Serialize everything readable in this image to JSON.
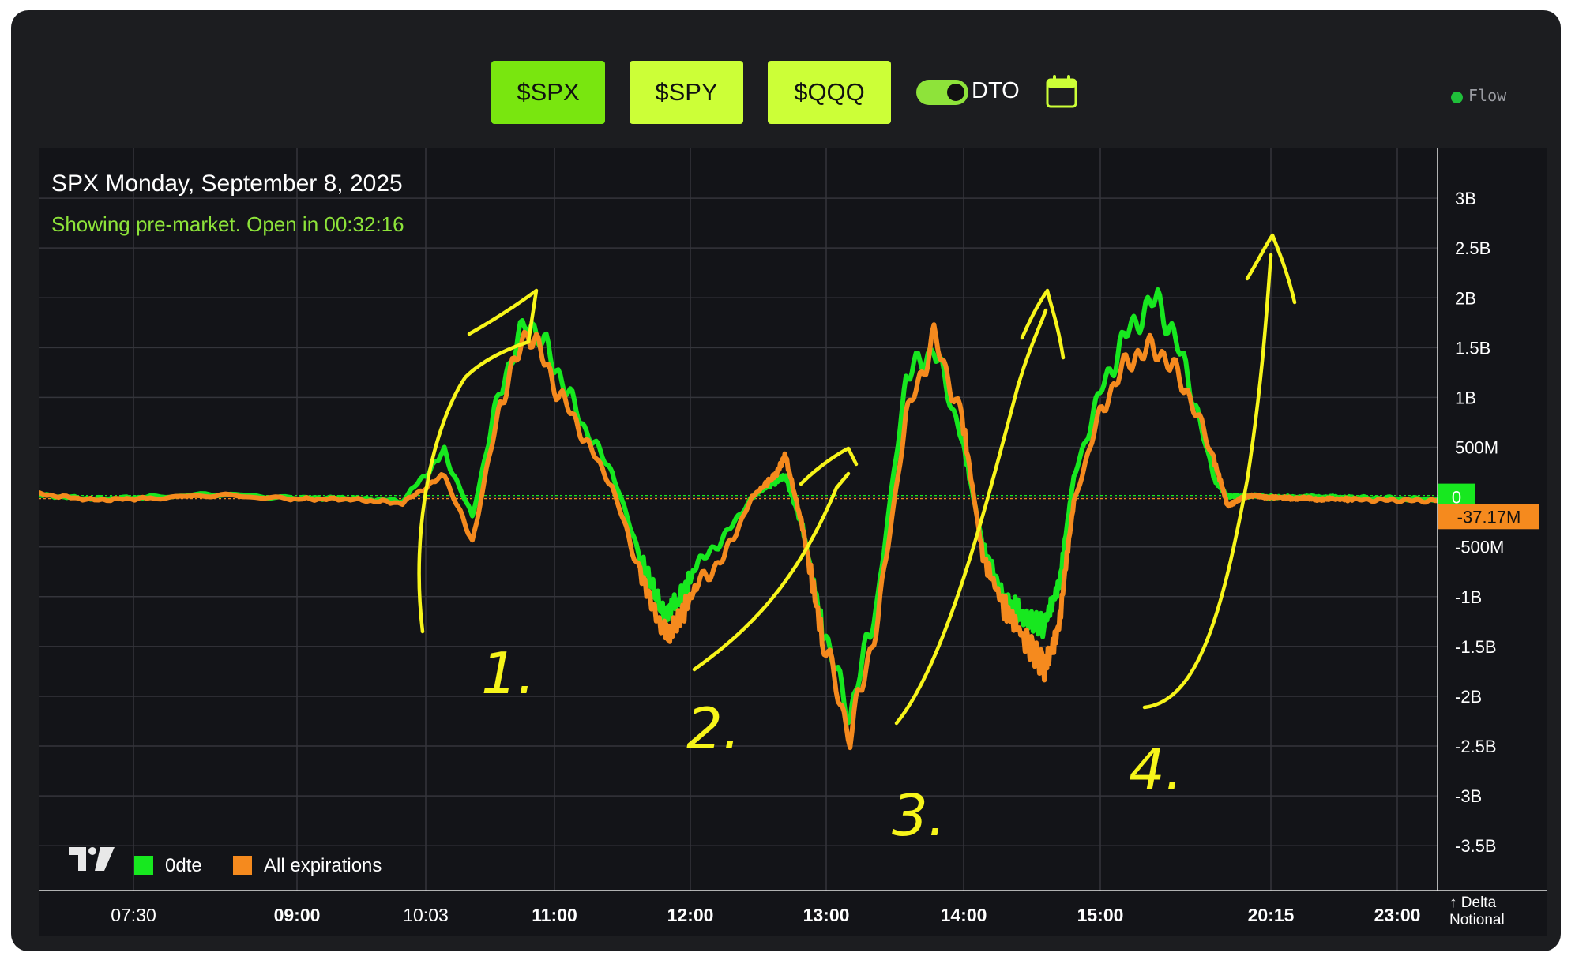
{
  "toolbar": {
    "buttons": [
      "$SPX",
      "$SPY",
      "$QQQ"
    ],
    "active_button": "$SPX",
    "toggle_label": "DTO",
    "toggle_on": true,
    "calendar_icon": "calendar-icon",
    "flow_label": "Flow",
    "colors": {
      "active": "#79e60f",
      "inactive": "#ccff37",
      "flow_dot": "#1fbf3a"
    }
  },
  "chart_data": {
    "type": "line",
    "title": "SPX Monday, September 8, 2025",
    "subtitle": "Showing pre-market. Open in 00:32:16",
    "x_tick_labels": [
      "07:30",
      "09:00",
      "10:03",
      "11:00",
      "12:00",
      "13:00",
      "14:00",
      "15:00",
      "20:15",
      "23:00"
    ],
    "bold_x_ticks": [
      "09:00",
      "11:00",
      "12:00",
      "13:00",
      "14:00",
      "15:00",
      "20:15",
      "23:00"
    ],
    "y_tick_labels": [
      "3B",
      "2.5B",
      "2B",
      "1.5B",
      "1B",
      "500M",
      "0",
      "-500M",
      "-1B",
      "-1.5B",
      "-2B",
      "-2.5B",
      "-3B",
      "-3.5B"
    ],
    "y_ticks": [
      3000,
      2500,
      2000,
      1500,
      1000,
      500,
      0,
      -500,
      -1000,
      -1500,
      -2000,
      -2500,
      -3000,
      -3500
    ],
    "ylim": [
      -3950,
      3500
    ],
    "y_unit": "M",
    "axis_label": "↑ Delta Notional",
    "zero_label": "0",
    "last_value_label": "-37.17M",
    "grid": true,
    "legend": {
      "position": "bottom-left",
      "logo": "tradingview-logo",
      "entries": [
        {
          "name": "0dte",
          "color": "#17e81f"
        },
        {
          "name": "All expirations",
          "color": "#f58a1e"
        }
      ]
    },
    "annotations": [
      "1.",
      "2.",
      "3.",
      "4."
    ],
    "x_positions": [
      0,
      4,
      8,
      13,
      18,
      22,
      26,
      29,
      31,
      33,
      35,
      37,
      39,
      41,
      43,
      44.6,
      45.5,
      47,
      49,
      51,
      52.5,
      53.4,
      54.6,
      56,
      58,
      60,
      62,
      64,
      66,
      67.5,
      69,
      70.4,
      72,
      73,
      74,
      76,
      78,
      80,
      82,
      84,
      85,
      86,
      87,
      88,
      89.5,
      90.5,
      91.5,
      92.5,
      94,
      96,
      98,
      100
    ],
    "series": [
      {
        "name": "0dte",
        "color": "#17e81f",
        "values": [
          20,
          -20,
          0,
          30,
          -10,
          -10,
          -40,
          450,
          -200,
          1100,
          1800,
          1300,
          700,
          250,
          -600,
          -1150,
          -1100,
          -700,
          -400,
          0,
          150,
          200,
          -300,
          -1300,
          -2200,
          -1000,
          1200,
          1500,
          600,
          -500,
          -1000,
          -1200,
          -1300,
          -800,
          200,
          1100,
          1700,
          2000,
          1300,
          200,
          0,
          10,
          10,
          0,
          0,
          0,
          0,
          0,
          -10,
          -10,
          -20,
          -20
        ]
      },
      {
        "name": "All expirations",
        "color": "#f58a1e",
        "values": [
          30,
          -30,
          -10,
          20,
          -20,
          -20,
          -60,
          220,
          -450,
          950,
          1700,
          1100,
          600,
          100,
          -750,
          -1350,
          -1300,
          -900,
          -600,
          0,
          200,
          400,
          -300,
          -1400,
          -2400,
          -1200,
          800,
          1600,
          800,
          -600,
          -1100,
          -1400,
          -1700,
          -1200,
          -50,
          900,
          1400,
          1500,
          1100,
          400,
          -100,
          0,
          10,
          0,
          -10,
          -15,
          -20,
          -20,
          -25,
          -30,
          -35,
          -37.17
        ]
      }
    ]
  }
}
